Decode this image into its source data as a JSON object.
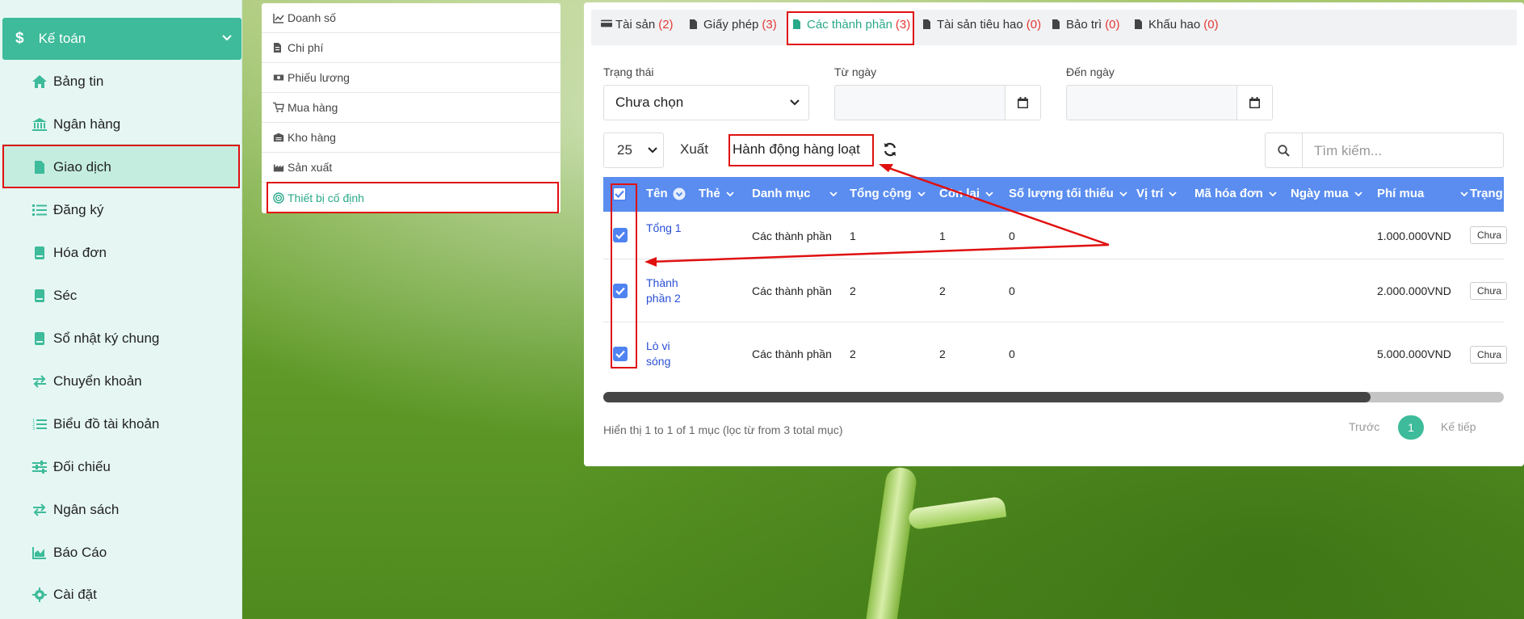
{
  "colors": {
    "accent": "#3dbb9a",
    "table_header": "#5a8def",
    "highlight": "#e01010",
    "count": "#e53935"
  },
  "sidebar": {
    "header_label": "Kế toán",
    "items": [
      {
        "label": "Bảng tin",
        "icon": "home-icon"
      },
      {
        "label": "Ngân hàng",
        "icon": "bank-icon"
      },
      {
        "label": "Giao dịch",
        "icon": "file-icon"
      },
      {
        "label": "Đăng ký",
        "icon": "list-icon"
      },
      {
        "label": "Hóa đơn",
        "icon": "book-icon"
      },
      {
        "label": "Séc",
        "icon": "book-icon"
      },
      {
        "label": "Sổ nhật ký chung",
        "icon": "book-icon"
      },
      {
        "label": "Chuyển khoản",
        "icon": "exchange-icon"
      },
      {
        "label": "Biểu đồ tài khoản",
        "icon": "list-ol-icon"
      },
      {
        "label": "Đối chiếu",
        "icon": "sliders-icon"
      },
      {
        "label": "Ngân sách",
        "icon": "exchange-icon"
      },
      {
        "label": "Báo Cáo",
        "icon": "chart-area-icon"
      },
      {
        "label": "Cài đặt",
        "icon": "gear-icon"
      }
    ]
  },
  "submenu": {
    "items": [
      {
        "label": "Doanh số",
        "icon": "line-chart-icon"
      },
      {
        "label": "Chi phí",
        "icon": "file-invoice-icon"
      },
      {
        "label": "Phiếu lương",
        "icon": "money-icon"
      },
      {
        "label": "Mua hàng",
        "icon": "cart-icon"
      },
      {
        "label": "Kho hàng",
        "icon": "warehouse-icon"
      },
      {
        "label": "Sản xuất",
        "icon": "industry-icon"
      },
      {
        "label": "Thiết bị cố định",
        "icon": "target-icon"
      }
    ]
  },
  "tabs": [
    {
      "label": "Tài sản",
      "count": "(2)"
    },
    {
      "label": "Giấy phép",
      "count": "(3)"
    },
    {
      "label": "Các thành phần",
      "count": "(3)"
    },
    {
      "label": "Tài sản tiêu hao",
      "count": "(0)"
    },
    {
      "label": "Bảo trì",
      "count": "(0)"
    },
    {
      "label": "Khấu hao",
      "count": "(0)"
    }
  ],
  "filters": {
    "status_label": "Trạng thái",
    "status_value": "Chưa chọn",
    "from_label": "Từ ngày",
    "to_label": "Đến ngày"
  },
  "toolbar": {
    "page_size": "25",
    "export_label": "Xuất",
    "bulk_label": "Hành động hàng loạt",
    "search_placeholder": "Tìm kiếm..."
  },
  "table": {
    "columns": [
      "Tên",
      "Thẻ",
      "Danh mục",
      "Tổng cộng",
      "Còn lại",
      "Số lượng tối thiểu",
      "Vị trí",
      "Mã hóa đơn",
      "Ngày mua",
      "Phí mua",
      "Trạng"
    ],
    "rows": [
      {
        "name": "Tổng 1",
        "category": "Các thành phần",
        "total": "1",
        "remaining": "1",
        "min_qty": "0",
        "cost": "1.000.000VND",
        "status": "Chưa"
      },
      {
        "name": "Thành phần 2",
        "category": "Các thành phần",
        "total": "2",
        "remaining": "2",
        "min_qty": "0",
        "cost": "2.000.000VND",
        "status": "Chưa"
      },
      {
        "name": "Lò vi sóng",
        "category": "Các thành phần",
        "total": "2",
        "remaining": "2",
        "min_qty": "0",
        "cost": "5.000.000VND",
        "status": "Chưa"
      }
    ]
  },
  "footer": {
    "info": "Hiển thị 1 to 1 of 1 mục (lọc từ from 3 total mục)",
    "prev": "Trước",
    "current_page": "1",
    "next": "Kế tiếp"
  }
}
